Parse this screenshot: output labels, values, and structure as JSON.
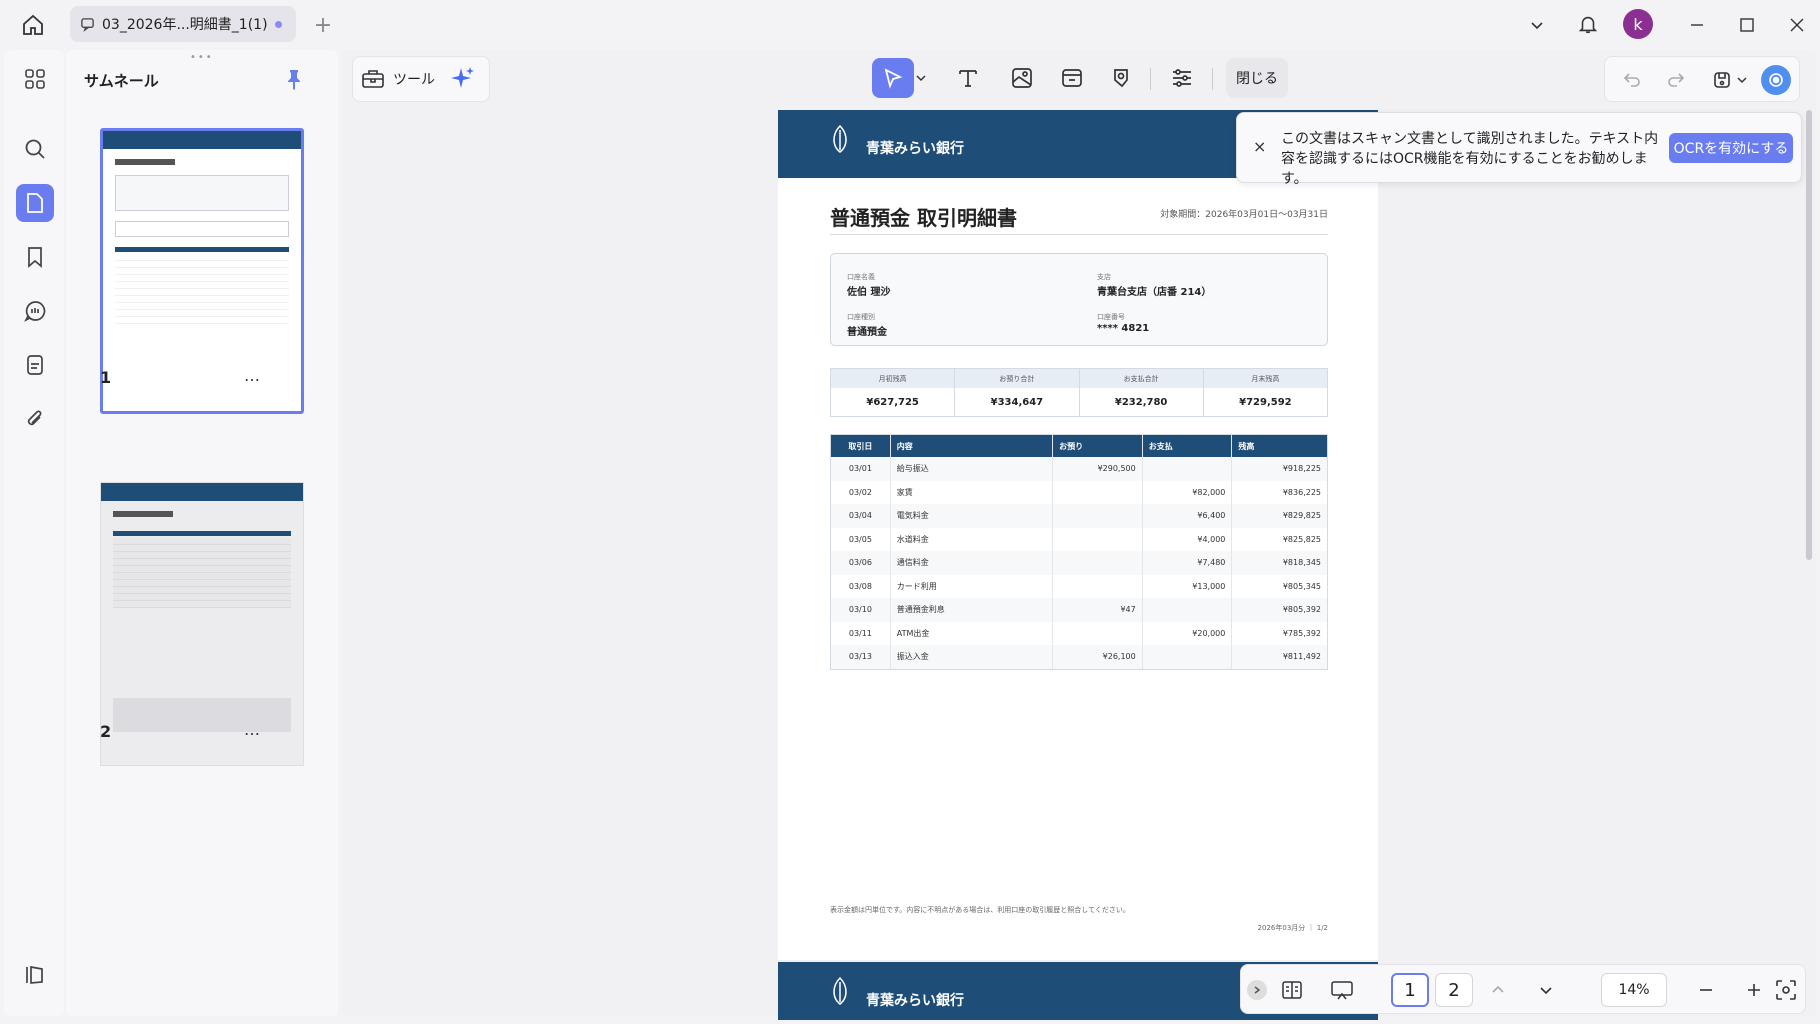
{
  "window": {
    "tab_title": "03_2026年...明細書_1(1)",
    "avatar_letter": "k"
  },
  "sidebar": {
    "panel_title": "サムネール",
    "thumbnails": [
      {
        "page": "1",
        "more": "…"
      },
      {
        "page": "2",
        "more": "…"
      }
    ]
  },
  "toolbar": {
    "tools_label": "ツール",
    "close_label": "閉じる"
  },
  "document": {
    "bank_name": "青葉みらい銀行",
    "title": "普通預金 取引明細書",
    "period": "対象期間：2026年03月01日～03月31日",
    "account": {
      "holder_label": "口座名義",
      "holder_value": "佐伯 理沙",
      "branch_label": "支店",
      "branch_value": "青葉台支店（店番 214）",
      "type_label": "口座種別",
      "type_value": "普通預金",
      "number_label": "口座番号",
      "number_value": "**** 4821"
    },
    "summary": [
      {
        "label": "月初残高",
        "value": "¥627,725"
      },
      {
        "label": "お預り合計",
        "value": "¥334,647"
      },
      {
        "label": "お支払合計",
        "value": "¥232,780"
      },
      {
        "label": "月末残高",
        "value": "¥729,592"
      }
    ],
    "tx_headers": {
      "date": "取引日",
      "desc": "内容",
      "deposit": "お預り",
      "withdrawal": "お支払",
      "balance": "残高"
    },
    "transactions": [
      {
        "date": "03/01",
        "desc": "給与振込",
        "deposit": "¥290,500",
        "withdrawal": "",
        "balance": "¥918,225"
      },
      {
        "date": "03/02",
        "desc": "家賃",
        "deposit": "",
        "withdrawal": "¥82,000",
        "balance": "¥836,225"
      },
      {
        "date": "03/04",
        "desc": "電気料金",
        "deposit": "",
        "withdrawal": "¥6,400",
        "balance": "¥829,825"
      },
      {
        "date": "03/05",
        "desc": "水道料金",
        "deposit": "",
        "withdrawal": "¥4,000",
        "balance": "¥825,825"
      },
      {
        "date": "03/06",
        "desc": "通信料金",
        "deposit": "",
        "withdrawal": "¥7,480",
        "balance": "¥818,345"
      },
      {
        "date": "03/08",
        "desc": "カード利用",
        "deposit": "",
        "withdrawal": "¥13,000",
        "balance": "¥805,345"
      },
      {
        "date": "03/10",
        "desc": "普通預金利息",
        "deposit": "¥47",
        "withdrawal": "",
        "balance": "¥805,392"
      },
      {
        "date": "03/11",
        "desc": "ATM出金",
        "deposit": "",
        "withdrawal": "¥20,000",
        "balance": "¥785,392"
      },
      {
        "date": "03/13",
        "desc": "振込入金",
        "deposit": "¥26,100",
        "withdrawal": "",
        "balance": "¥811,492"
      }
    ],
    "note": "表示金額は円単位です。内容に不明点がある場合は、利用口座の取引履歴と照合してください。",
    "footer": "2026年03月分 ｜ 1/2"
  },
  "ocr_toast": {
    "close": "×",
    "message": "この文書はスキャン文書として識別されました。テキスト内容を認識するにはOCR機能を有効にすることをお勧めします。",
    "button": "OCRを有効にする"
  },
  "bottom_nav": {
    "page1": "1",
    "page2": "2",
    "zoom": "14%"
  }
}
